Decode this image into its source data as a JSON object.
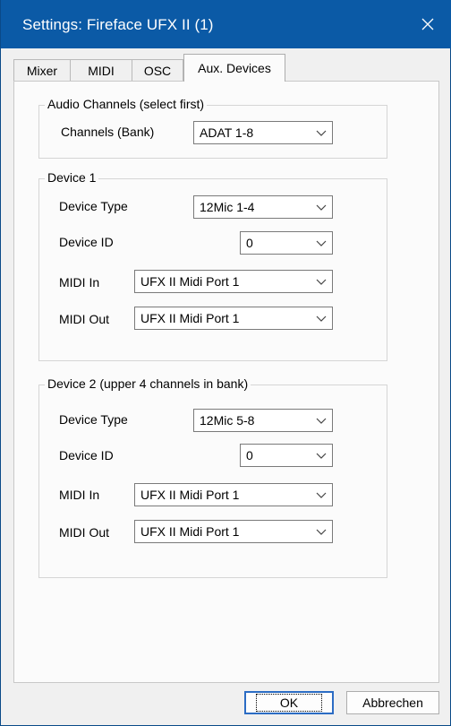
{
  "window": {
    "title": "Settings: Fireface UFX II (1)"
  },
  "tabs": [
    {
      "label": "Mixer"
    },
    {
      "label": "MIDI"
    },
    {
      "label": "OSC"
    },
    {
      "label": "Aux. Devices",
      "active": true
    }
  ],
  "audio_channels": {
    "legend": "Audio Channels (select first)",
    "channels_label": "Channels (Bank)",
    "channels_value": "ADAT 1-8"
  },
  "device1": {
    "legend": "Device 1",
    "type_label": "Device Type",
    "type_value": "12Mic 1-4",
    "id_label": "Device ID",
    "id_value": "0",
    "midi_in_label": "MIDI In",
    "midi_in_value": "UFX II Midi Port 1",
    "midi_out_label": "MIDI Out",
    "midi_out_value": "UFX II Midi Port 1"
  },
  "device2": {
    "legend": "Device 2 (upper 4 channels in bank)",
    "type_label": "Device Type",
    "type_value": "12Mic 5-8",
    "id_label": "Device ID",
    "id_value": "0",
    "midi_in_label": "MIDI In",
    "midi_in_value": "UFX II Midi Port 1",
    "midi_out_label": "MIDI Out",
    "midi_out_value": "UFX II Midi Port 1"
  },
  "buttons": {
    "ok": "OK",
    "cancel": "Abbrechen"
  },
  "colors": {
    "titlebar": "#0b5aa6",
    "accent": "#2b6cc4"
  },
  "icons": {
    "close": "close-icon",
    "dropdown": "chevron-down-icon"
  }
}
